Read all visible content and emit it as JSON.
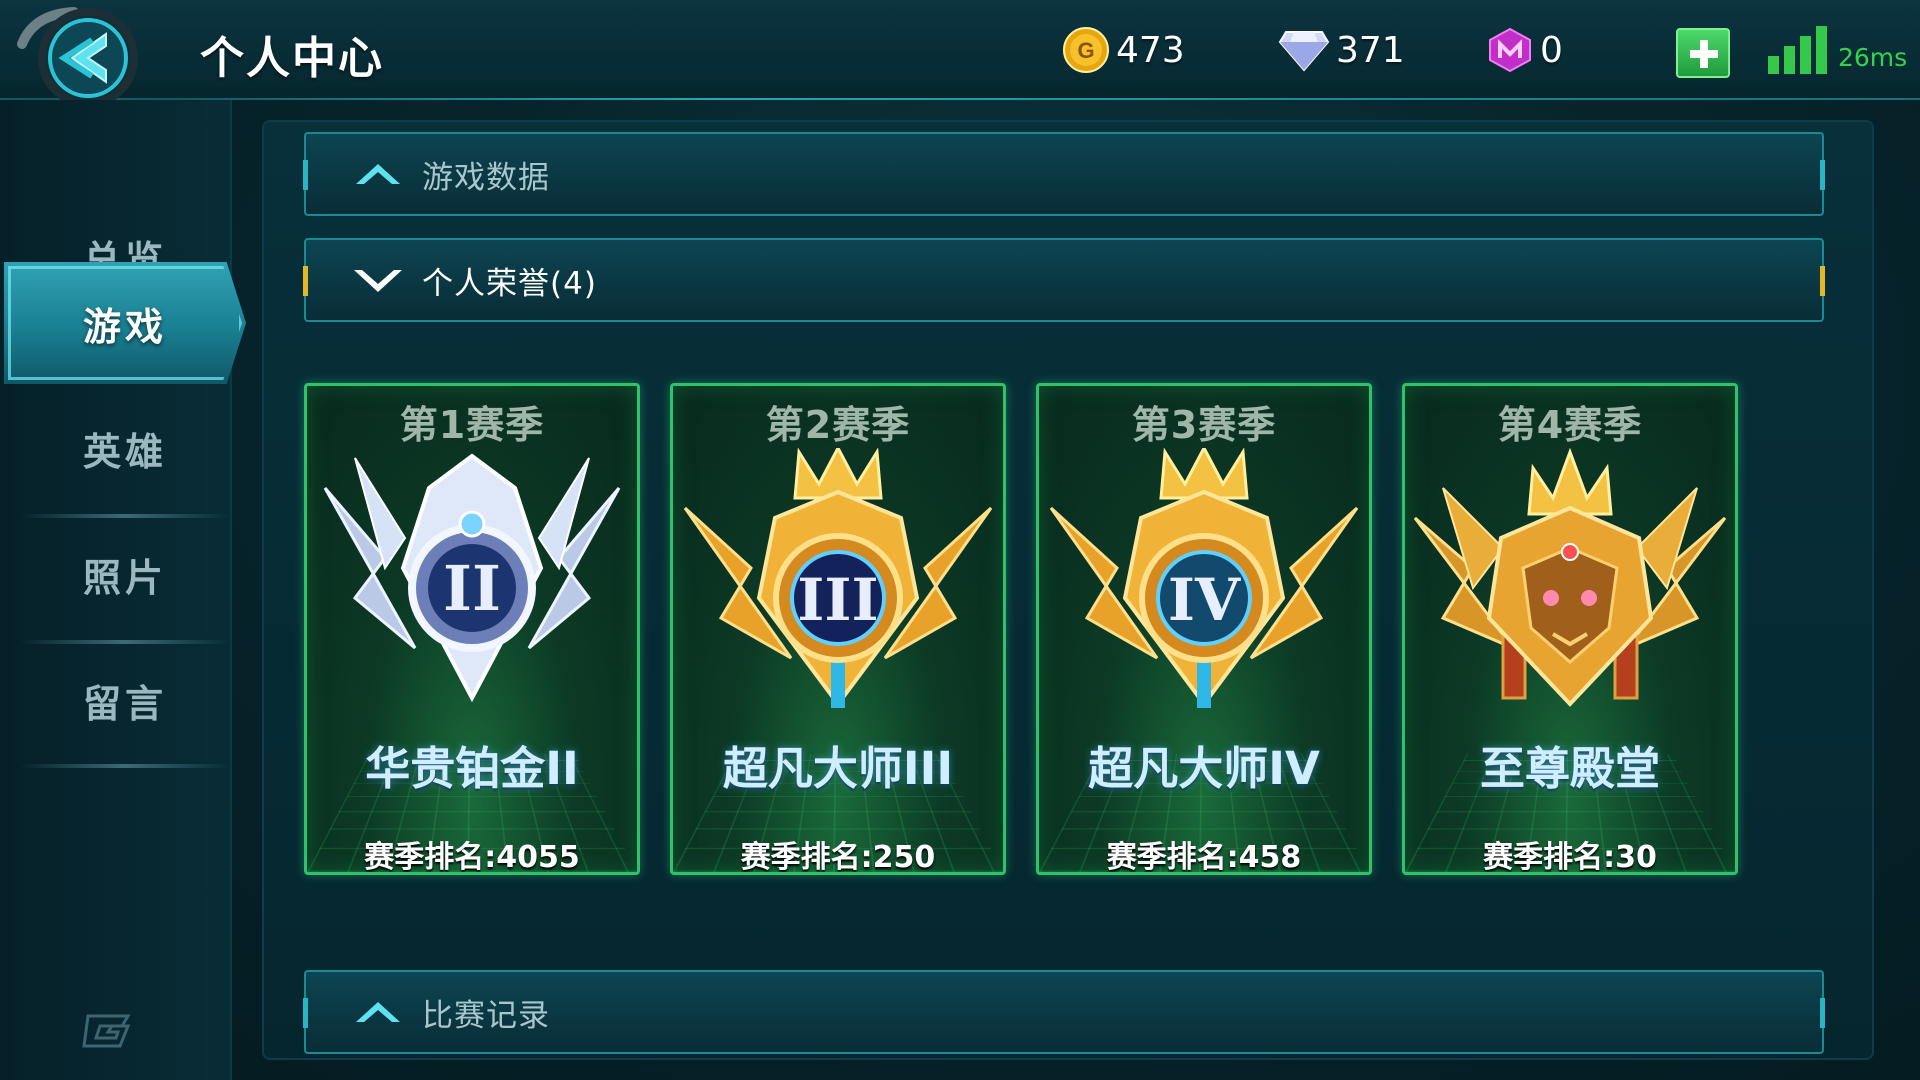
{
  "header": {
    "title": "个人中心",
    "currencies": [
      {
        "name": "gold",
        "value": "473"
      },
      {
        "name": "diamond",
        "value": "371"
      },
      {
        "name": "gem",
        "value": "0"
      }
    ],
    "ping": "26ms",
    "colors": {
      "accent": "#2bb5c2",
      "signal": "#36c84a",
      "card_border": "#2ec26a",
      "expanded_marker": "#e3b92a"
    }
  },
  "sidebar": {
    "items": [
      {
        "label": "总览",
        "active": false
      },
      {
        "label": "游戏",
        "active": true
      },
      {
        "label": "英雄",
        "active": false
      },
      {
        "label": "照片",
        "active": false
      },
      {
        "label": "留言",
        "active": false
      }
    ]
  },
  "sections": [
    {
      "label": "游戏数据",
      "expanded": false
    },
    {
      "label": "个人荣誉(4)",
      "expanded": true
    },
    {
      "label": "比赛记录",
      "expanded": false
    }
  ],
  "honors": [
    {
      "season": "第1赛季",
      "rank": "华贵铂金II",
      "ranking": "赛季排名:4055",
      "emblem": "platinum-ii-emblem",
      "numeral": "II"
    },
    {
      "season": "第2赛季",
      "rank": "超凡大师III",
      "ranking": "赛季排名:250",
      "emblem": "master-iii-emblem",
      "numeral": "III"
    },
    {
      "season": "第3赛季",
      "rank": "超凡大师IV",
      "ranking": "赛季排名:458",
      "emblem": "master-iv-emblem",
      "numeral": "IV"
    },
    {
      "season": "第4赛季",
      "rank": "至尊殿堂",
      "ranking": "赛季排名:30",
      "emblem": "supreme-hall-emblem",
      "numeral": ""
    }
  ]
}
